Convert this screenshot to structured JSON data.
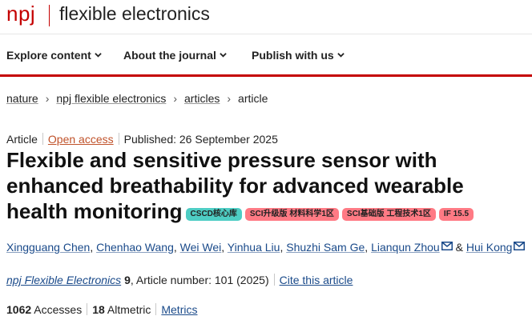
{
  "header": {
    "logo_npj": "npj",
    "journal_name": "flexible electronics"
  },
  "nav": {
    "items": [
      {
        "label": "Explore content"
      },
      {
        "label": "About the journal"
      },
      {
        "label": "Publish with us"
      }
    ]
  },
  "breadcrumb": {
    "items": [
      "nature",
      "npj flexible electronics",
      "articles"
    ],
    "current": "article"
  },
  "meta": {
    "type": "Article",
    "access": "Open access",
    "published": "Published: 26 September 2025"
  },
  "title": "Flexible and sensitive pressure sensor with enhanced breathability for advanced wearable health monitoring",
  "badges": [
    {
      "label": "CSCD核心库",
      "color": "#4ecdc4"
    },
    {
      "label": "SCI升级版 材料科学1区",
      "color": "#ff7a84"
    },
    {
      "label": "SCI基础版 工程技术1区",
      "color": "#ff7a84"
    },
    {
      "label": "IF 15.5",
      "color": "#ff7a84"
    }
  ],
  "authors": {
    "names": [
      "Xingguang Chen",
      "Chenhao Wang",
      "Wei Wei",
      "Yinhua Liu",
      "Shuzhi Sam Ge",
      "Lianqun Zhou",
      "Hui Kong"
    ],
    "separator": ", ",
    "conjunction": "&"
  },
  "citation": {
    "journal": "npj Flexible Electronics",
    "volume": "9",
    "rest": ", Article number: 101 (2025)",
    "cite_label": "Cite this article"
  },
  "metrics": {
    "accesses_count": "1062",
    "accesses_label": "Accesses",
    "altmetric_count": "18",
    "altmetric_label": "Altmetric",
    "metrics_label": "Metrics"
  },
  "colors": {
    "brand_red": "#c40000",
    "link_blue": "#1a4a8a",
    "open_access": "#c0522a"
  }
}
